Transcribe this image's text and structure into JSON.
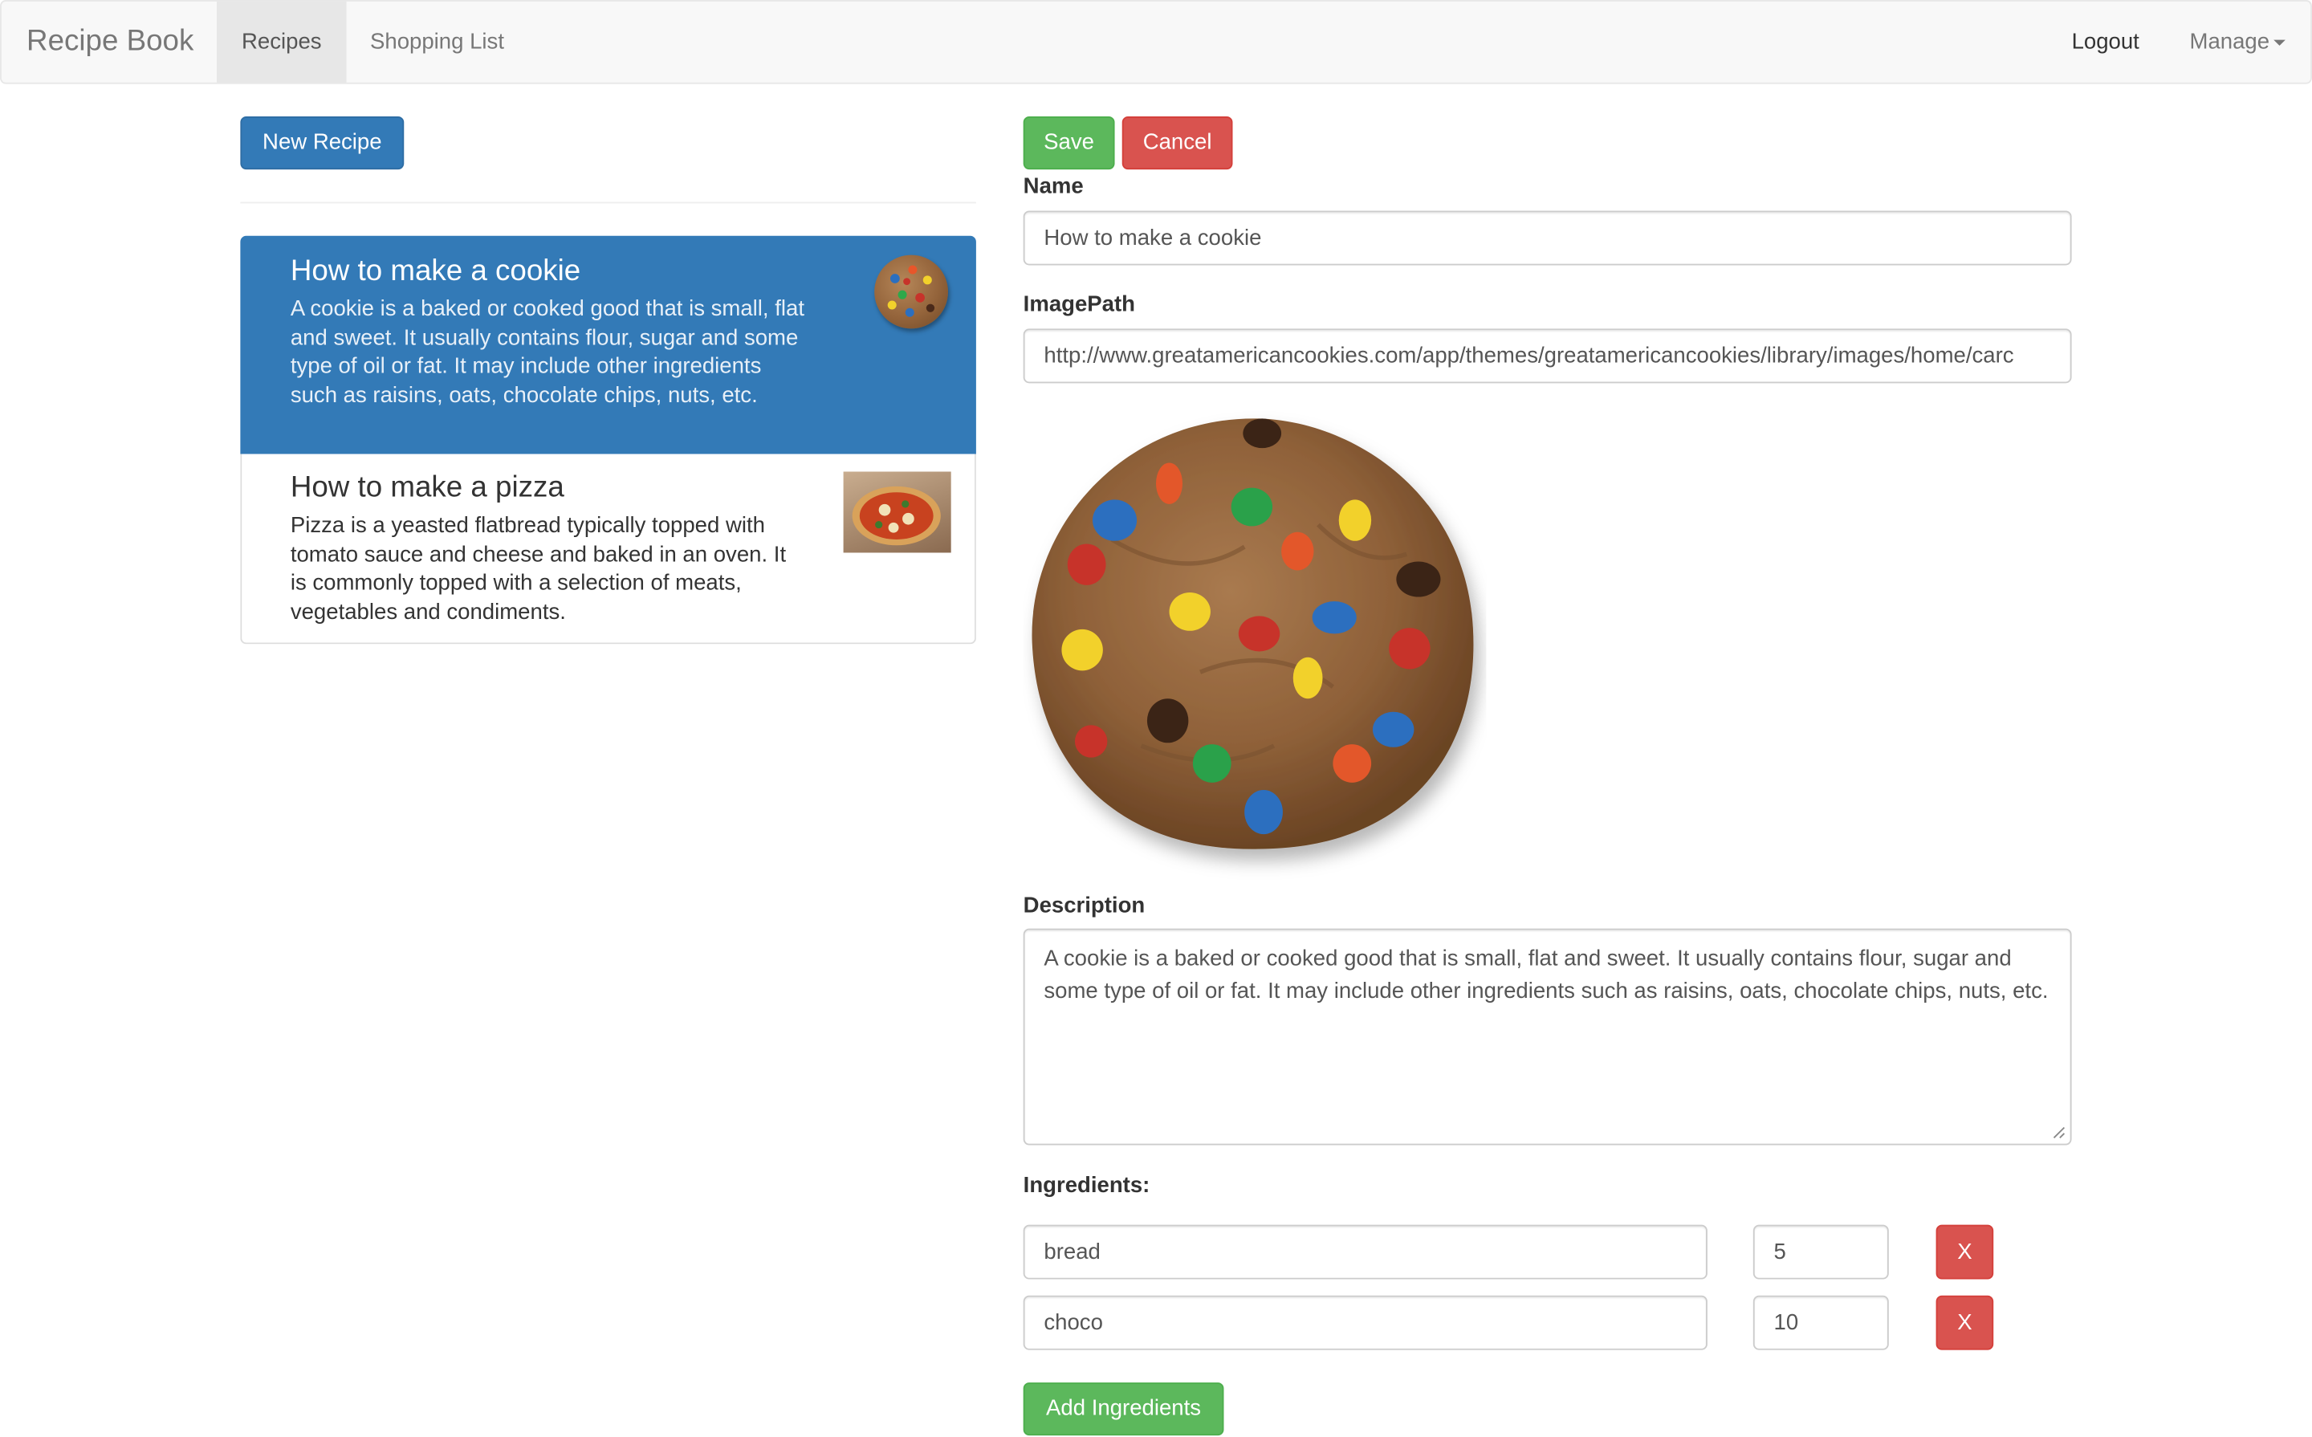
{
  "navbar": {
    "brand": "Recipe Book",
    "links": [
      "Recipes",
      "Shopping List"
    ],
    "active": "Recipes",
    "right": {
      "logout": "Logout",
      "manage": "Manage"
    }
  },
  "sidebar": {
    "new_recipe_label": "New Recipe",
    "recipes": [
      {
        "name": "How to make a cookie",
        "description": "A cookie is a baked or cooked good that is small, flat and sweet. It usually contains flour, sugar and some type of oil or fat. It may include other ingredients such as raisins, oats, chocolate chips, nuts, etc.",
        "active": true,
        "thumbnail": "cookie-image"
      },
      {
        "name": "How to make a pizza",
        "description": "Pizza is a yeasted flatbread typically topped with tomato sauce and cheese and baked in an oven. It is commonly topped with a selection of meats, vegetables and condiments.",
        "active": false,
        "thumbnail": "pizza-image"
      }
    ]
  },
  "editor": {
    "save_label": "Save",
    "cancel_label": "Cancel",
    "name_label": "Name",
    "name_value": "How to make a cookie",
    "image_path_label": "ImagePath",
    "image_path_value": "http://www.greatamericancookies.com/app/themes/greatamericancookies/library/images/home/carc",
    "description_label": "Description",
    "description_value": "A cookie is a baked or cooked good that is small, flat and sweet. It usually contains flour, sugar and some type of oil or fat. It may include other ingredients such as raisins, oats, chocolate chips, nuts, etc.",
    "ingredients_label": "Ingredients:",
    "ingredients": [
      {
        "name": "bread",
        "amount": "5",
        "remove_label": "X"
      },
      {
        "name": "choco",
        "amount": "10",
        "remove_label": "X"
      }
    ],
    "add_ingredients_label": "Add Ingredients"
  },
  "colors": {
    "primary": "#337ab7",
    "success": "#5cb85c",
    "danger": "#d9534f",
    "navbar_bg": "#f8f8f8"
  }
}
